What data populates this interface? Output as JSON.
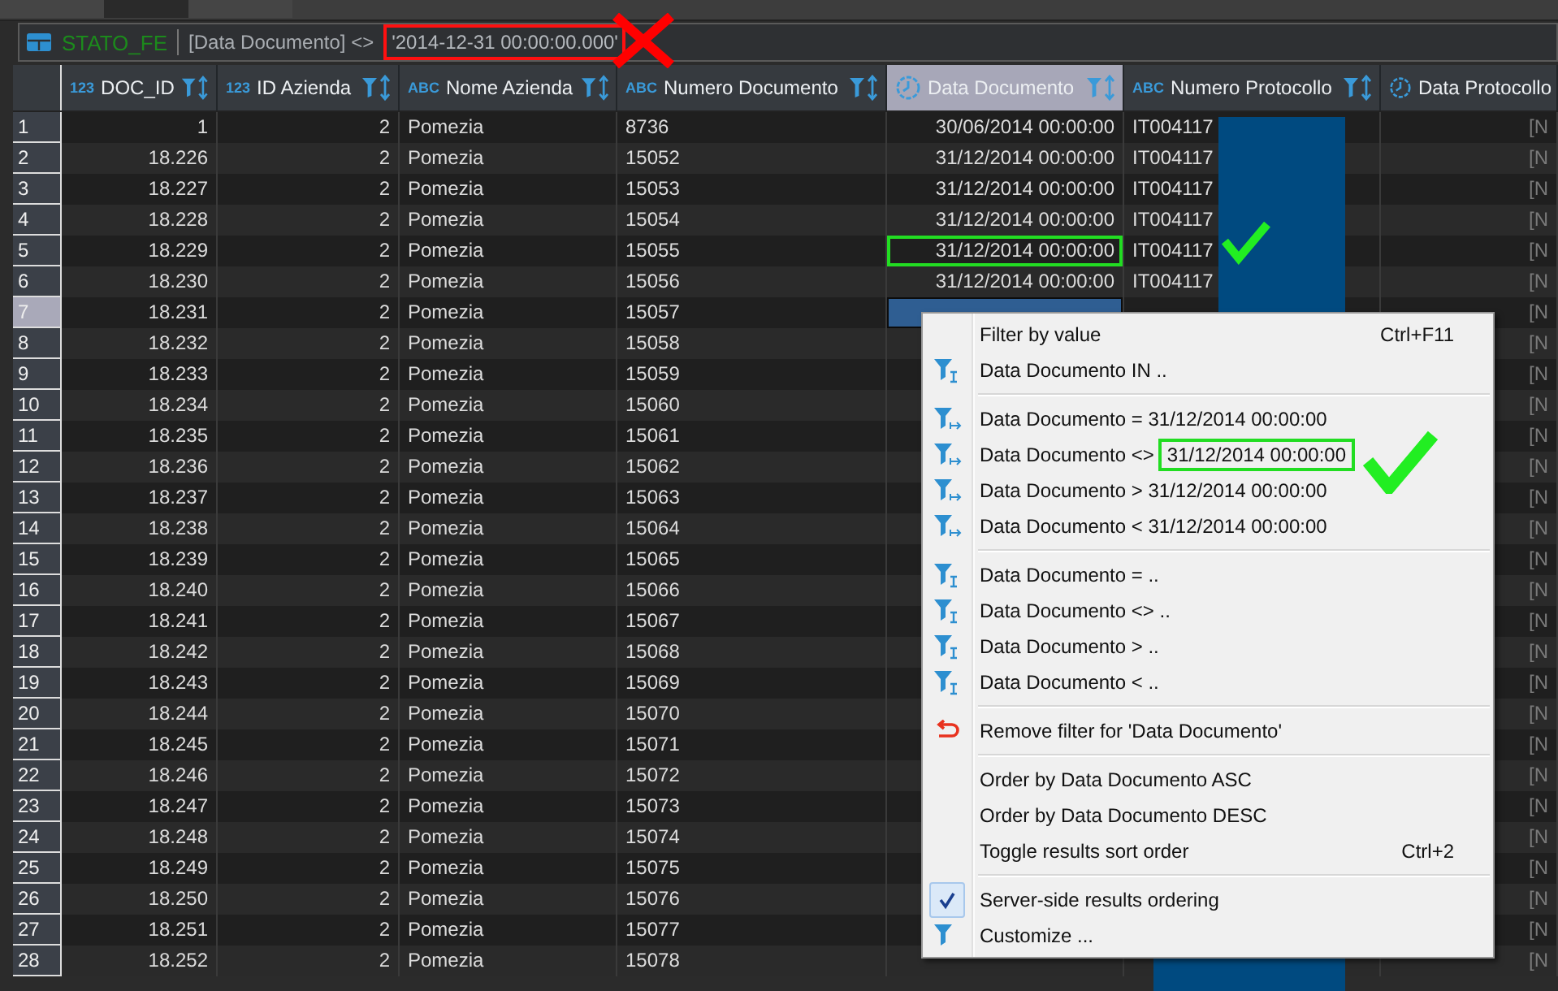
{
  "filter_bar": {
    "source": "STATO_FE",
    "expression": "[Data Documento] <>",
    "value": "'2014-12-31 00:00:00.000'",
    "value_boxed": true,
    "annotated": true
  },
  "columns": [
    {
      "name": "DOC_ID",
      "kind": "number",
      "type_label": "123",
      "selected": false
    },
    {
      "name": "ID Azienda",
      "kind": "number",
      "type_label": "123",
      "selected": false
    },
    {
      "name": "Nome Azienda",
      "kind": "text",
      "type_label": "ABC",
      "selected": false
    },
    {
      "name": "Numero Documento",
      "kind": "text",
      "type_label": "ABC",
      "selected": false
    },
    {
      "name": "Data Documento",
      "kind": "date",
      "selected": true
    },
    {
      "name": "Numero Protocollo",
      "kind": "text",
      "type_label": "ABC",
      "selected": false
    },
    {
      "name": "Data Protocollo",
      "kind": "date",
      "selected": false,
      "values_muted": true
    }
  ],
  "rows": [
    {
      "number": "1",
      "selected": false,
      "cells": [
        "1",
        "2",
        "Pomezia",
        "8736",
        "30/06/2014 00:00:00",
        "IT004117",
        "[N"
      ]
    },
    {
      "number": "2",
      "selected": false,
      "cells": [
        "18.226",
        "2",
        "Pomezia",
        "15052",
        "31/12/2014 00:00:00",
        "IT004117",
        "[N"
      ]
    },
    {
      "number": "3",
      "selected": false,
      "cells": [
        "18.227",
        "2",
        "Pomezia",
        "15053",
        "31/12/2014 00:00:00",
        "IT004117",
        "[N"
      ]
    },
    {
      "number": "4",
      "selected": false,
      "cells": [
        "18.228",
        "2",
        "Pomezia",
        "15054",
        "31/12/2014 00:00:00",
        "IT004117",
        "[N"
      ]
    },
    {
      "number": "5",
      "selected": false,
      "annotated": true,
      "cells": [
        "18.229",
        "2",
        "Pomezia",
        "15055",
        "31/12/2014 00:00:00",
        "IT004117",
        "[N"
      ]
    },
    {
      "number": "6",
      "selected": false,
      "cells": [
        "18.230",
        "2",
        "Pomezia",
        "15056",
        "31/12/2014 00:00:00",
        "IT004117",
        "[N"
      ]
    },
    {
      "number": "7",
      "selected": true,
      "cells": [
        "18.231",
        "2",
        "Pomezia",
        "15057",
        null,
        null,
        "[N"
      ]
    },
    {
      "number": "8",
      "selected": false,
      "cells": [
        "18.232",
        "2",
        "Pomezia",
        "15058",
        null,
        null,
        "[N"
      ]
    },
    {
      "number": "9",
      "selected": false,
      "cells": [
        "18.233",
        "2",
        "Pomezia",
        "15059",
        null,
        null,
        "[N"
      ]
    },
    {
      "number": "10",
      "selected": false,
      "cells": [
        "18.234",
        "2",
        "Pomezia",
        "15060",
        null,
        null,
        "[N"
      ]
    },
    {
      "number": "11",
      "selected": false,
      "cells": [
        "18.235",
        "2",
        "Pomezia",
        "15061",
        null,
        null,
        "[N"
      ]
    },
    {
      "number": "12",
      "selected": false,
      "cells": [
        "18.236",
        "2",
        "Pomezia",
        "15062",
        null,
        null,
        "[N"
      ]
    },
    {
      "number": "13",
      "selected": false,
      "cells": [
        "18.237",
        "2",
        "Pomezia",
        "15063",
        null,
        null,
        "[N"
      ]
    },
    {
      "number": "14",
      "selected": false,
      "cells": [
        "18.238",
        "2",
        "Pomezia",
        "15064",
        null,
        null,
        "[N"
      ]
    },
    {
      "number": "15",
      "selected": false,
      "cells": [
        "18.239",
        "2",
        "Pomezia",
        "15065",
        null,
        null,
        "[N"
      ]
    },
    {
      "number": "16",
      "selected": false,
      "cells": [
        "18.240",
        "2",
        "Pomezia",
        "15066",
        null,
        null,
        "[N"
      ]
    },
    {
      "number": "17",
      "selected": false,
      "cells": [
        "18.241",
        "2",
        "Pomezia",
        "15067",
        null,
        null,
        "[N"
      ]
    },
    {
      "number": "18",
      "selected": false,
      "cells": [
        "18.242",
        "2",
        "Pomezia",
        "15068",
        null,
        null,
        "[N"
      ]
    },
    {
      "number": "19",
      "selected": false,
      "cells": [
        "18.243",
        "2",
        "Pomezia",
        "15069",
        null,
        null,
        "[N"
      ]
    },
    {
      "number": "20",
      "selected": false,
      "cells": [
        "18.244",
        "2",
        "Pomezia",
        "15070",
        null,
        null,
        "[N"
      ]
    },
    {
      "number": "21",
      "selected": false,
      "cells": [
        "18.245",
        "2",
        "Pomezia",
        "15071",
        null,
        null,
        "[N"
      ]
    },
    {
      "number": "22",
      "selected": false,
      "cells": [
        "18.246",
        "2",
        "Pomezia",
        "15072",
        null,
        null,
        "[N"
      ]
    },
    {
      "number": "23",
      "selected": false,
      "cells": [
        "18.247",
        "2",
        "Pomezia",
        "15073",
        null,
        null,
        "[N"
      ]
    },
    {
      "number": "24",
      "selected": false,
      "cells": [
        "18.248",
        "2",
        "Pomezia",
        "15074",
        null,
        null,
        "[N"
      ]
    },
    {
      "number": "25",
      "selected": false,
      "cells": [
        "18.249",
        "2",
        "Pomezia",
        "15075",
        null,
        null,
        "[N"
      ]
    },
    {
      "number": "26",
      "selected": false,
      "cells": [
        "18.250",
        "2",
        "Pomezia",
        "15076",
        null,
        null,
        "[N"
      ]
    },
    {
      "number": "27",
      "selected": false,
      "cells": [
        "18.251",
        "2",
        "Pomezia",
        "15077",
        null,
        null,
        "[N"
      ]
    },
    {
      "number": "28",
      "selected": false,
      "cells": [
        "18.252",
        "2",
        "Pomezia",
        "15078",
        null,
        null,
        "[N"
      ]
    }
  ],
  "context_menu": {
    "groups": [
      [
        {
          "label": "Filter by value",
          "shortcut": "Ctrl+F11",
          "kind": "plain"
        },
        {
          "label": "Data Documento IN ..",
          "kind": "input-filter"
        }
      ],
      [
        {
          "label": "Data Documento = 31/12/2014 00:00:00",
          "kind": "value-filter"
        },
        {
          "label": "Data Documento <>",
          "value": "31/12/2014 00:00:00",
          "value_boxed": true,
          "annotated": true,
          "kind": "value-filter"
        },
        {
          "label": "Data Documento > 31/12/2014 00:00:00",
          "kind": "value-filter"
        },
        {
          "label": "Data Documento < 31/12/2014 00:00:00",
          "kind": "value-filter"
        }
      ],
      [
        {
          "label": "Data Documento = ..",
          "kind": "input-filter"
        },
        {
          "label": "Data Documento <> ..",
          "kind": "input-filter"
        },
        {
          "label": "Data Documento > ..",
          "kind": "input-filter"
        },
        {
          "label": "Data Documento < ..",
          "kind": "input-filter"
        }
      ],
      [
        {
          "label": "Remove filter for 'Data Documento'",
          "kind": "remove"
        }
      ],
      [
        {
          "label": "Order by Data Documento ASC",
          "kind": "plain"
        },
        {
          "label": "Order by Data Documento DESC",
          "kind": "plain"
        },
        {
          "label": "Toggle results sort order",
          "shortcut": "Ctrl+2",
          "kind": "plain"
        }
      ],
      [
        {
          "label": "Server-side results ordering",
          "kind": "toggle",
          "checked": true
        },
        {
          "label": "Customize ...",
          "kind": "customize"
        }
      ]
    ]
  }
}
